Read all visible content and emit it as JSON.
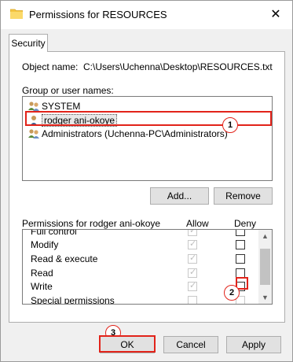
{
  "window": {
    "title": "Permissions for RESOURCES",
    "close_glyph": "✕"
  },
  "tab": {
    "label": "Security"
  },
  "object": {
    "label": "Object name:",
    "value": "C:\\Users\\Uchenna\\Desktop\\RESOURCES.txt"
  },
  "group": {
    "label": "Group or user names:",
    "users": [
      {
        "label": "SYSTEM",
        "icon": "users-group-icon"
      },
      {
        "label": "rodger ani-okoye",
        "icon": "user-icon",
        "selected": true
      },
      {
        "label": "Administrators (Uchenna-PC\\Administrators)",
        "icon": "users-group-icon"
      }
    ]
  },
  "buttons": {
    "add": "Add...",
    "remove": "Remove",
    "ok": "OK",
    "cancel": "Cancel",
    "apply": "Apply"
  },
  "permissions": {
    "header": "Permissions for rodger ani-okoye",
    "allow_header": "Allow",
    "deny_header": "Deny",
    "rows": [
      {
        "name": "Full control",
        "allow": true,
        "deny": false
      },
      {
        "name": "Modify",
        "allow": true,
        "deny": false
      },
      {
        "name": "Read & execute",
        "allow": true,
        "deny": false
      },
      {
        "name": "Read",
        "allow": true,
        "deny": false
      },
      {
        "name": "Write",
        "allow": true,
        "deny": false
      },
      {
        "name": "Special permissions",
        "allow": false,
        "deny": false
      }
    ]
  },
  "callouts": [
    "1",
    "2",
    "3"
  ],
  "colors": {
    "highlight": "#e2231a",
    "checkbox_disabled": "#bdbdbd"
  }
}
